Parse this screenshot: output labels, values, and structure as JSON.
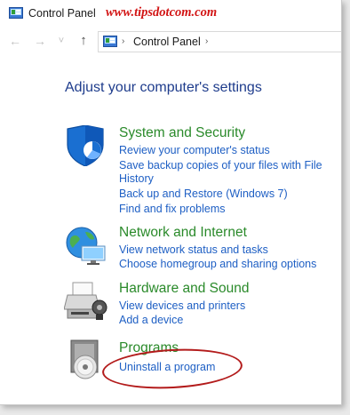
{
  "window": {
    "title": "Control Panel",
    "watermark": "www.tipsdotcom.com"
  },
  "nav": {
    "back": "←",
    "forward": "→",
    "recent": "˅",
    "up": "↑",
    "breadcrumb_sep": "›",
    "breadcrumb": "Control Panel"
  },
  "main": {
    "heading": "Adjust your computer's settings",
    "categories": [
      {
        "title": "System and Security",
        "icon": "shield-icon",
        "links": [
          "Review your computer's status",
          "Save backup copies of your files with File",
          "History",
          "Back up and Restore (Windows 7)",
          "Find and fix problems"
        ]
      },
      {
        "title": "Network and Internet",
        "icon": "network-globe-icon",
        "links": [
          "View network status and tasks",
          "Choose homegroup and sharing options"
        ]
      },
      {
        "title": "Hardware and Sound",
        "icon": "printer-icon",
        "links": [
          "View devices and printers",
          "Add a device"
        ]
      },
      {
        "title": "Programs",
        "icon": "programs-disc-icon",
        "links": [
          "Uninstall a program"
        ]
      }
    ]
  },
  "colors": {
    "heading": "#1e3c8c",
    "category_title": "#2a8a2a",
    "link": "#1e5fc4",
    "watermark": "#d21414",
    "highlight_oval": "#b31b1b"
  }
}
